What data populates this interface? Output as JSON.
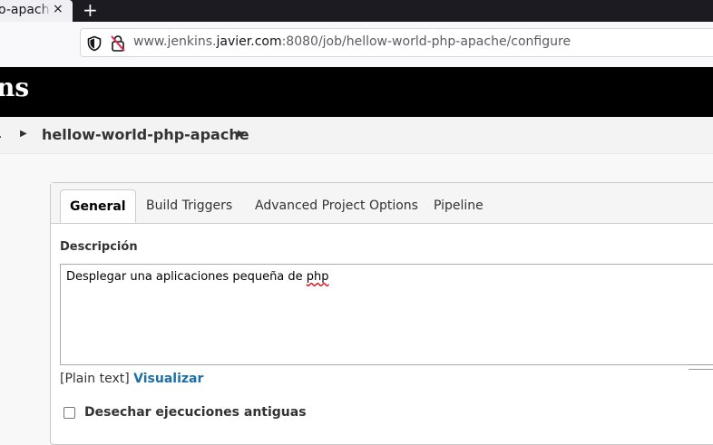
{
  "browser": {
    "tab_title": "o-apache",
    "tab_close": "×",
    "new_tab": "+",
    "url_prefix": "www.jenkins.",
    "url_domain": "javier.com",
    "url_suffix": ":8080/job/hellow-world-php-apache/configure"
  },
  "header": {
    "title": "ns"
  },
  "breadcrumb": {
    "leading": ".",
    "job": "hellow-world-php-apache"
  },
  "config_tabs": [
    {
      "label": "General",
      "active": true
    },
    {
      "label": "Build Triggers",
      "active": false
    },
    {
      "label": "Advanced Project Options",
      "active": false
    },
    {
      "label": "Pipeline",
      "active": false
    }
  ],
  "description": {
    "label": "Descripción",
    "value_main": "Desplegar una aplicaciones pequeña de ",
    "value_misspelled": "php",
    "format_text": "[Plain text]",
    "preview_link": "Visualizar"
  },
  "options": {
    "discard_old_builds": {
      "label": "Desechar ejecuciones antiguas",
      "checked": false
    }
  }
}
